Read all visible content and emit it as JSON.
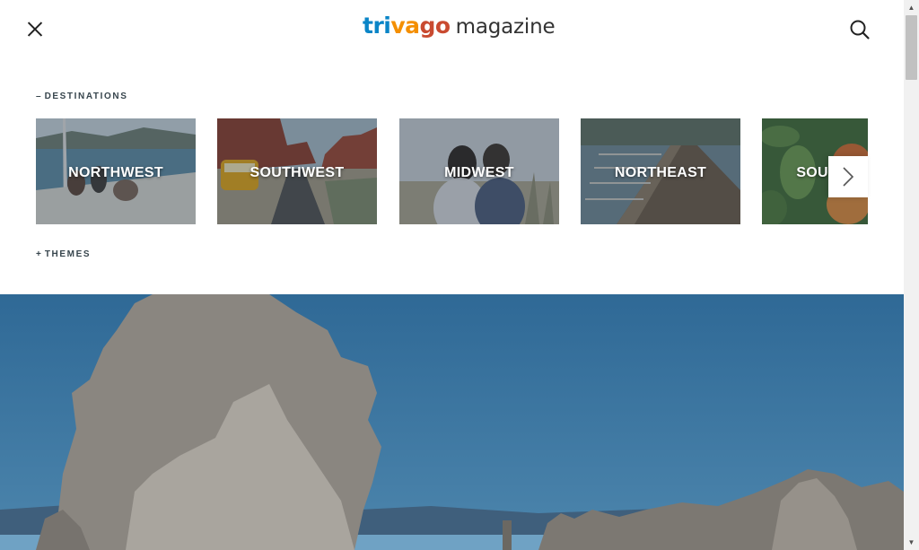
{
  "header": {
    "logo_part1": "tri",
    "logo_part2": "va",
    "logo_part3": "go",
    "logo_part4": "magazine"
  },
  "nav": {
    "destinations": {
      "symbol": "–",
      "label": "DESTINATIONS"
    },
    "themes": {
      "symbol": "+",
      "label": "THEMES"
    }
  },
  "destinations": [
    {
      "label": "NORTHWEST"
    },
    {
      "label": "SOUTHWEST"
    },
    {
      "label": "MIDWEST"
    },
    {
      "label": "NORTHEAST"
    },
    {
      "label": "SOUTHEAST"
    }
  ],
  "colors": {
    "brand_blue": "#0a85c7",
    "brand_orange": "#f48f00",
    "brand_red": "#c94a30",
    "hero_sky": "#2e6f9e"
  },
  "icons": {
    "close": "close-icon",
    "search": "search-icon",
    "next": "chevron-right-icon"
  }
}
